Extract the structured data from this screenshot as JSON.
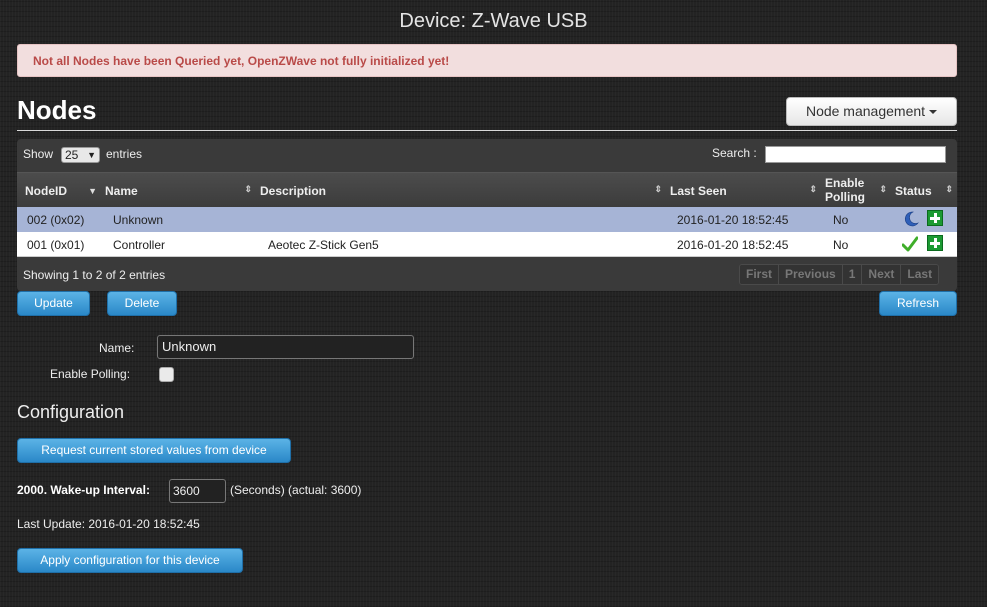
{
  "page": {
    "title": "Device: Z-Wave USB"
  },
  "alert": {
    "message": "Not all Nodes have been Queried yet, OpenZWave not fully initialized yet!"
  },
  "nodes_section": {
    "title": "Nodes",
    "node_management_label": "Node management"
  },
  "table": {
    "show_label": "Show",
    "entries_value": "25",
    "entries_label": "entries",
    "search_label": "Search :",
    "search_value": "",
    "columns": [
      {
        "label": "NodeID"
      },
      {
        "label": "Name"
      },
      {
        "label": "Description"
      },
      {
        "label": "Last Seen"
      },
      {
        "label": "Enable",
        "label2": "Polling"
      },
      {
        "label": "Status"
      }
    ],
    "rows": [
      {
        "nodeid": "002 (0x02)",
        "name": "Unknown",
        "description": "",
        "last_seen": "2016-01-20 18:52:45",
        "polling": "No",
        "status_icon": "moon-sleep-icon",
        "selected": true
      },
      {
        "nodeid": "001 (0x01)",
        "name": "Controller",
        "description": "Aeotec Z-Stick Gen5",
        "last_seen": "2016-01-20 18:52:45",
        "polling": "No",
        "status_icon": "checkmark-icon",
        "selected": false
      }
    ],
    "info": "Showing 1 to 2 of 2 entries",
    "pagination": [
      "First",
      "Previous",
      "1",
      "Next",
      "Last"
    ]
  },
  "actions": {
    "update_label": "Update",
    "delete_label": "Delete",
    "refresh_label": "Refresh"
  },
  "form": {
    "name_label": "Name:",
    "name_value": "Unknown",
    "polling_label": "Enable Polling:",
    "polling_checked": false
  },
  "configuration": {
    "title": "Configuration",
    "request_button_label": "Request current stored values from device",
    "wakeup_label": "2000. Wake-up Interval:",
    "wakeup_value": "3600",
    "wakeup_units": "(Seconds) (actual: 3600)",
    "last_update": "Last Update: 2016-01-20 18:52:45",
    "apply_button_label": "Apply configuration for this device"
  },
  "colors": {
    "accent_button": "#2a88c8",
    "alert_bg": "#f2dede",
    "alert_text": "#b94a48",
    "selected_row": "#a6b4d6",
    "icon_green": "#1c9a33"
  }
}
